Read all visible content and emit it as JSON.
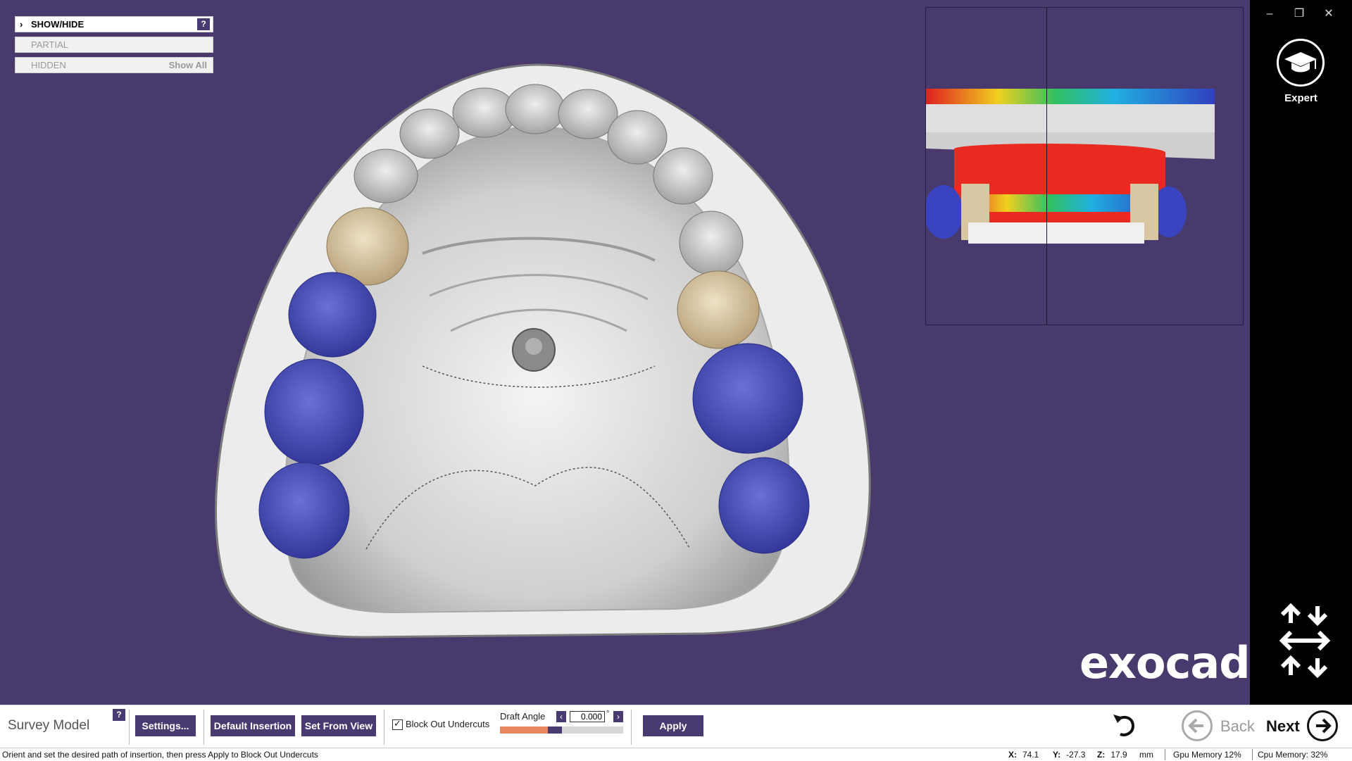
{
  "show_hide": {
    "header_label": "SHOW/HIDE",
    "help": "?",
    "partial_label": "PARTIAL",
    "hidden_label": "HIDDEN",
    "show_all_label": "Show All"
  },
  "window_controls": {
    "minimize": "–",
    "restore": "❐",
    "close": "✕"
  },
  "sidebar": {
    "expert_label": "Expert",
    "expert_icon": "graduation-cap-icon",
    "nav_icon": "view-arrows-icon"
  },
  "brand": {
    "logo_text": "exocad"
  },
  "toolbar": {
    "title": "Survey Model",
    "help": "?",
    "settings_label": "Settings...",
    "default_insertion_label": "Default Insertion",
    "set_from_view_label": "Set From View",
    "block_out_label": "Block Out Undercuts",
    "block_out_checked": true,
    "draft_angle_label": "Draft Angle",
    "draft_angle_value": "0.000",
    "draft_angle_unit": "°",
    "draft_slider_level": 0.44,
    "apply_label": "Apply",
    "back_label": "Back",
    "next_label": "Next"
  },
  "status_bar": {
    "message": "Orient and set the desired path of insertion, then press Apply to Block Out Undercuts",
    "x_label": "X:",
    "x_value": "74.1",
    "y_label": "Y:",
    "y_value": "-27.3",
    "z_label": "Z:",
    "z_value": "17.9",
    "unit": "mm",
    "gpu_memory": "Gpu Memory 12%",
    "cpu_memory": "Cpu Memory: 32%"
  },
  "colors": {
    "background": "#493a6e",
    "accent": "#4a3a72",
    "slider_fill": "#e8875e",
    "tooth_blue": "#4a4fb5",
    "tooth_beige": "#d9c7a4"
  }
}
